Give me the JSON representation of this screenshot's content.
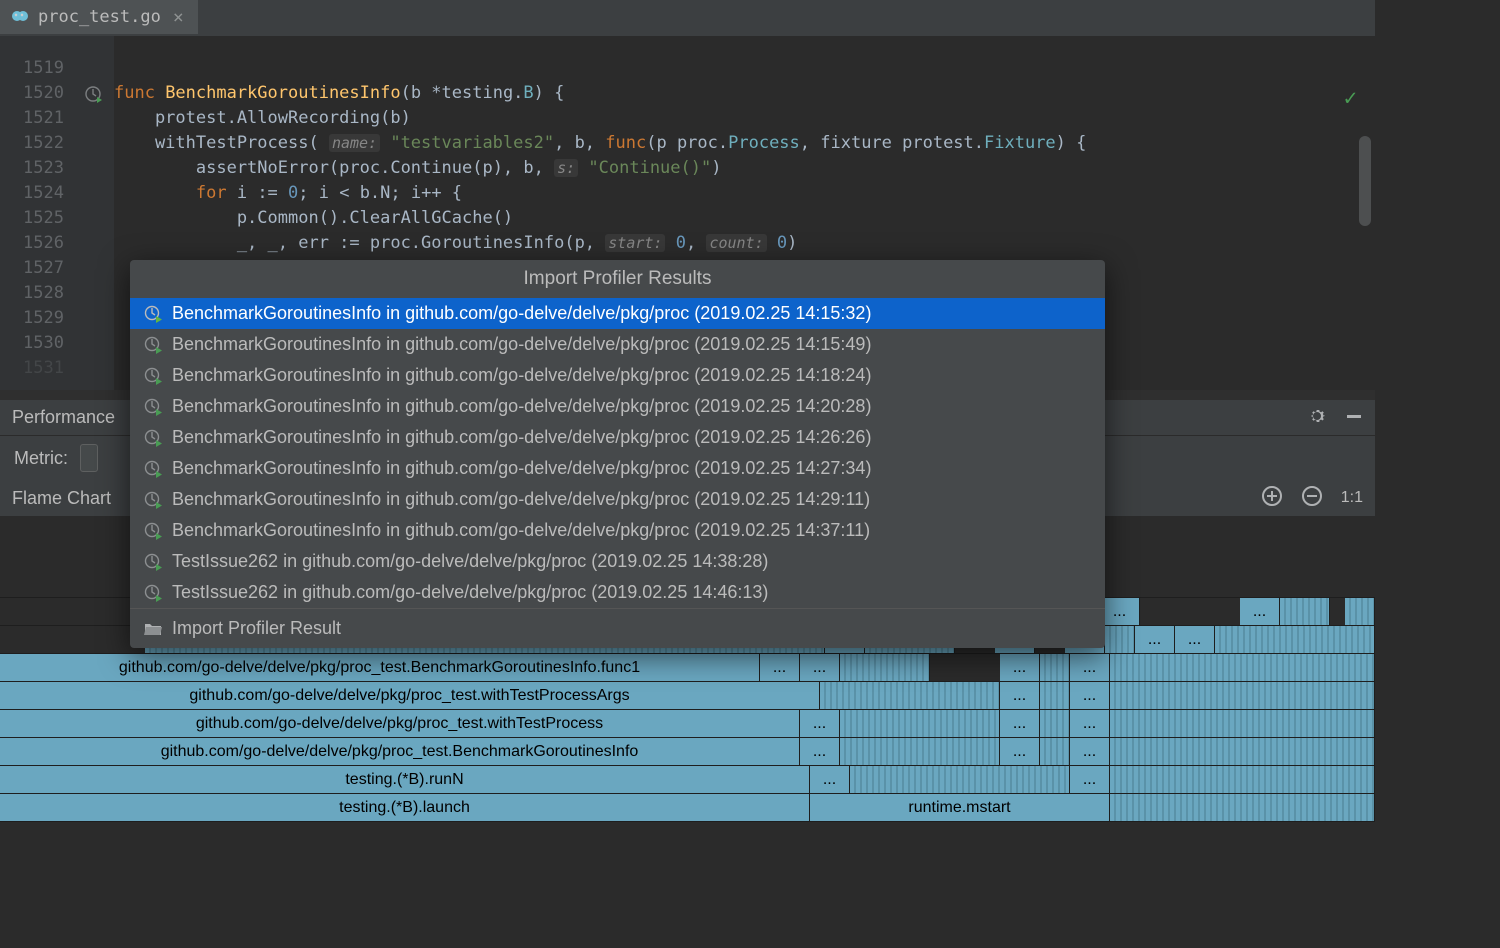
{
  "tab": {
    "filename": "proc_test.go"
  },
  "lineNumbers": [
    "1519",
    "1520",
    "1521",
    "1522",
    "1523",
    "1524",
    "1525",
    "1526",
    "1527",
    "1528",
    "1529",
    "1530",
    "1531"
  ],
  "code": {
    "l1520": {
      "kw1": "func ",
      "fn": "BenchmarkGoroutinesInfo",
      "p": "(b *testing.",
      "typ": "B",
      "p2": ") {"
    },
    "l1521": "    protest.AllowRecording(b)",
    "l1522": {
      "t": "    withTestProcess( ",
      "h1": "name:",
      "s": " \"testvariables2\"",
      "c": ", b, ",
      "kw": "func",
      "p": "(p proc.",
      "typ": "Process",
      "p2": ", fixture protest.",
      "typ2": "Fixture",
      "p3": ") {"
    },
    "l1523": {
      "t": "        assertNoError(proc.Continue(p), b, ",
      "h1": "s:",
      "s": " \"Continue()\"",
      "p": ")"
    },
    "l1524": {
      "kw": "for ",
      "t": "i := ",
      "n1": "0",
      "t2": "; i < b.N; i++ {"
    },
    "l1525": "            p.Common().ClearAllGCache()",
    "l1526": {
      "t": "            _, _, err := proc.GoroutinesInfo(p, ",
      "h1": "start:",
      "n1": " 0",
      "c": ", ",
      "h2": "count:",
      "n2": " 0",
      "p": ")"
    }
  },
  "popup": {
    "title": "Import Profiler Results",
    "items": [
      "BenchmarkGoroutinesInfo in github.com/go-delve/delve/pkg/proc (2019.02.25 14:15:32)",
      "BenchmarkGoroutinesInfo in github.com/go-delve/delve/pkg/proc (2019.02.25 14:15:49)",
      "BenchmarkGoroutinesInfo in github.com/go-delve/delve/pkg/proc (2019.02.25 14:18:24)",
      "BenchmarkGoroutinesInfo in github.com/go-delve/delve/pkg/proc (2019.02.25 14:20:28)",
      "BenchmarkGoroutinesInfo in github.com/go-delve/delve/pkg/proc (2019.02.25 14:26:26)",
      "BenchmarkGoroutinesInfo in github.com/go-delve/delve/pkg/proc (2019.02.25 14:27:34)",
      "BenchmarkGoroutinesInfo in github.com/go-delve/delve/pkg/proc (2019.02.25 14:29:11)",
      "BenchmarkGoroutinesInfo in github.com/go-delve/delve/pkg/proc (2019.02.25 14:37:11)",
      "TestIssue262 in github.com/go-delve/delve/pkg/proc (2019.02.25 14:38:28)",
      "TestIssue262 in github.com/go-delve/delve/pkg/proc (2019.02.25 14:46:13)"
    ],
    "footer": "Import Profiler Result"
  },
  "panel": {
    "tab": "Performance",
    "metric": "Metric:",
    "chartTab": "Flame Chart",
    "zoom": "1:1"
  },
  "flame": {
    "r0": {
      "a": "...",
      "b": "...",
      "c": "..."
    },
    "r1": {
      "a": "...",
      "b": "...",
      "c": "...",
      "d": "...",
      "e": "..."
    },
    "r2": {
      "main": "github.com/go-delve/delve/pkg/proc_test.BenchmarkGoroutinesInfo.func1",
      "a": "...",
      "b": "...",
      "c": "...",
      "d": "..."
    },
    "r3": {
      "main": "github.com/go-delve/delve/pkg/proc_test.withTestProcessArgs",
      "a": "...",
      "b": "..."
    },
    "r4": {
      "main": "github.com/go-delve/delve/pkg/proc_test.withTestProcess",
      "a": "...",
      "b": "...",
      "c": "..."
    },
    "r5": {
      "main": "github.com/go-delve/delve/pkg/proc_test.BenchmarkGoroutinesInfo",
      "a": "...",
      "b": "...",
      "c": "..."
    },
    "r6": {
      "main": "testing.(*B).runN",
      "a": "...",
      "b": "..."
    },
    "r7": {
      "main": "testing.(*B).launch",
      "side": "runtime.mstart"
    }
  }
}
